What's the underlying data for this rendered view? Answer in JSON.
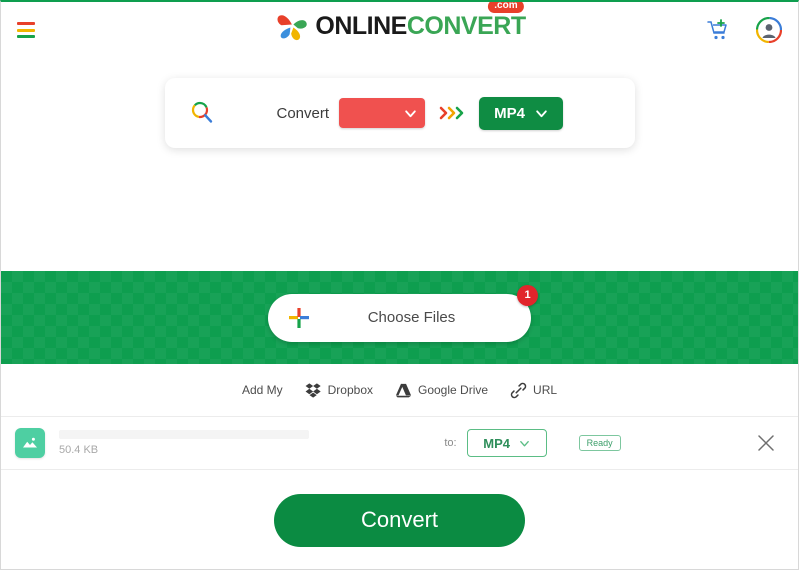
{
  "header": {
    "menu_icon": "hamburger-menu-icon",
    "logo": {
      "mark": "pinwheel-logo-icon",
      "text_primary": "ONLINE",
      "text_secondary": "CONVERT",
      "badge": ".com"
    },
    "cart_icon": "shopping-cart-add-icon",
    "avatar_icon": "user-avatar-icon"
  },
  "search": {
    "search_icon": "search-icon",
    "convert_label": "Convert",
    "from_format": "",
    "from_placeholder": "",
    "arrows_icon": "triple-chevron-right-icon",
    "to_format": "MP4"
  },
  "dropzone": {
    "plus_icon": "add-plus-icon",
    "choose_files_label": "Choose Files",
    "badge_count": "1"
  },
  "sources": {
    "add_my_label": "Add My",
    "items": [
      {
        "label": "Dropbox",
        "icon": "dropbox-icon"
      },
      {
        "label": "Google Drive",
        "icon": "google-drive-icon"
      },
      {
        "label": "URL",
        "icon": "link-icon"
      }
    ]
  },
  "file_row": {
    "thumb_icon": "image-file-icon",
    "file_name": "",
    "file_size": "50.4 KB",
    "to_label": "to:",
    "to_format": "MP4",
    "status": "Ready",
    "remove_icon": "close-x-icon"
  },
  "footer": {
    "convert_button_label": "Convert"
  },
  "colors": {
    "brand_green": "#0e9e4f",
    "dark_green": "#0b8b42",
    "accent_red": "#e8402a",
    "badge_red": "#e1252b",
    "from_red": "#f0514f",
    "thumb_teal": "#4ecfa2"
  }
}
